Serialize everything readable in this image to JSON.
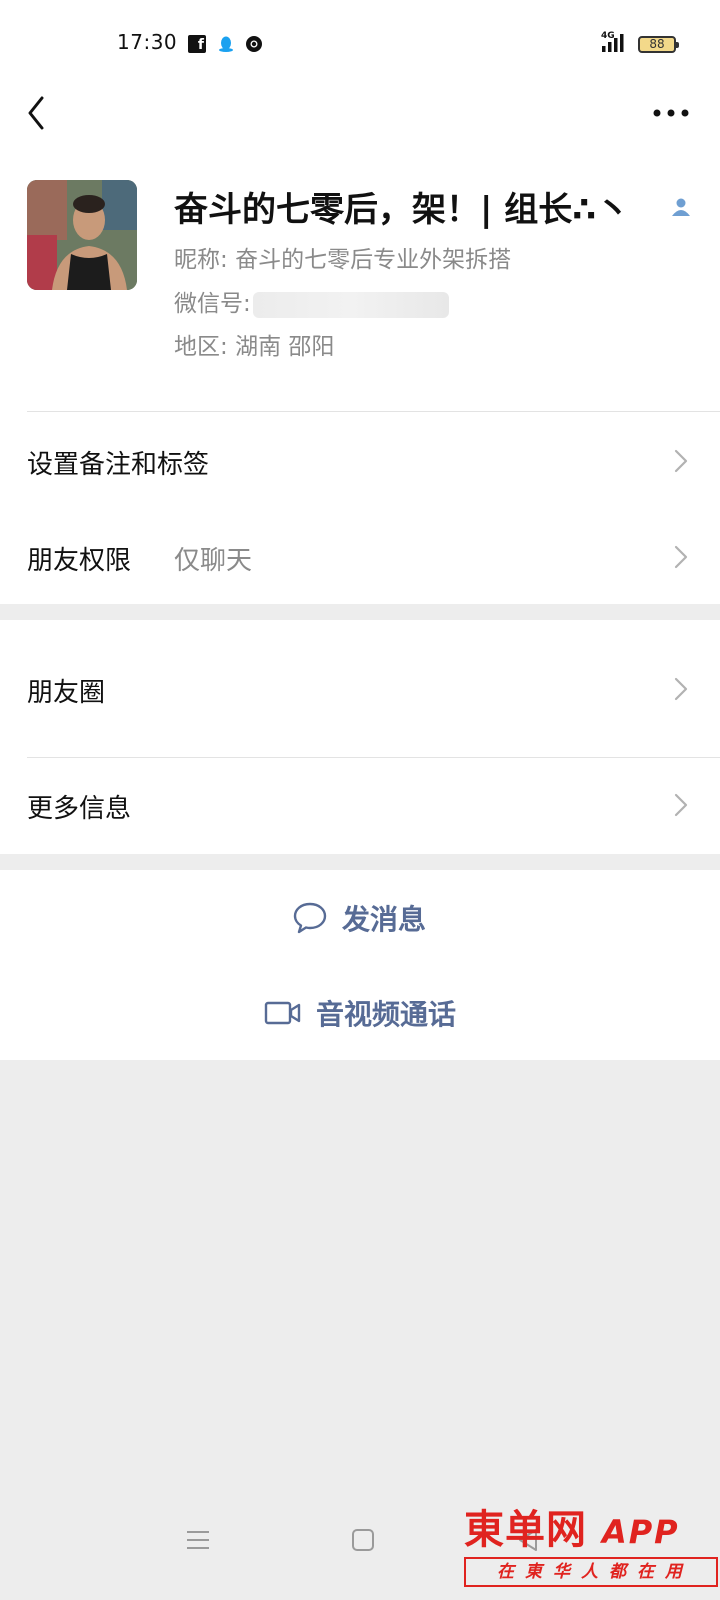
{
  "status_bar": {
    "time": "17:30",
    "network": "4G",
    "battery": "88"
  },
  "nav": {
    "back_icon": "chevron-left-icon",
    "more_icon": "more-dots-icon"
  },
  "profile": {
    "display_name": "奋斗的七零后，架！| 组长∴丶",
    "nickname_label": "昵称: ",
    "nickname": "奋斗的七零后专业外架拆搭",
    "wechat_id_label": "微信号:",
    "region_label": "地区: ",
    "region": "湖南  邵阳"
  },
  "rows": [
    {
      "label": "设置备注和标签",
      "value": ""
    },
    {
      "label": "朋友权限",
      "value": "仅聊天"
    },
    {
      "label": "朋友圈",
      "value": ""
    },
    {
      "label": "更多信息",
      "value": ""
    }
  ],
  "actions": {
    "message": "发消息",
    "call": "音视频通话"
  },
  "watermark": {
    "brand": "東单网",
    "app": "APP",
    "slogan": "在東华人都在用"
  },
  "colors": {
    "link_blue": "#576b95",
    "background_gray": "#ededed",
    "watermark_red": "#e0231f"
  }
}
